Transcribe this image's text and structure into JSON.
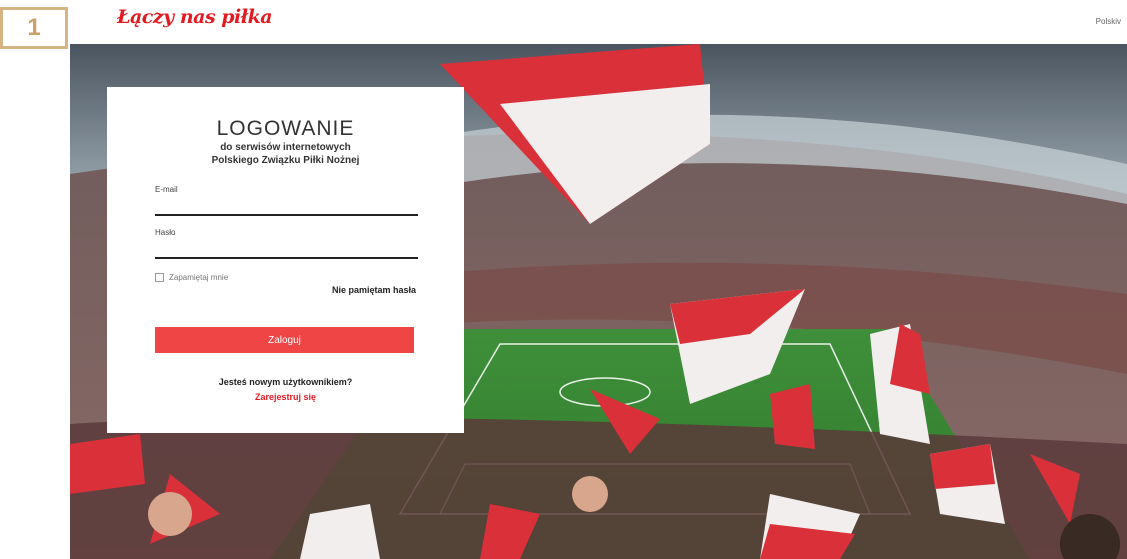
{
  "badge": {
    "number": "1"
  },
  "header": {
    "logo_text": "Łączy nas piłka",
    "language": "Polskiv"
  },
  "colors": {
    "brand_red": "#e21b22",
    "button_red": "#f04545",
    "badge_border": "#d4b483"
  },
  "login": {
    "title": "LOGOWANIE",
    "subtitle_line1": "do serwisów internetowych",
    "subtitle_line2": "Polskiego Związku Piłki Nożnej",
    "email_label": "E-mail",
    "email_value": "",
    "password_label": "Hasło",
    "password_value": "",
    "remember_label": "Zapamiętaj mnie",
    "forgot_label": "Nie pamiętam hasła",
    "submit_label": "Zaloguj",
    "new_user_text": "Jesteś nowym użytkownikiem?",
    "register_label": "Zarejestruj się"
  }
}
